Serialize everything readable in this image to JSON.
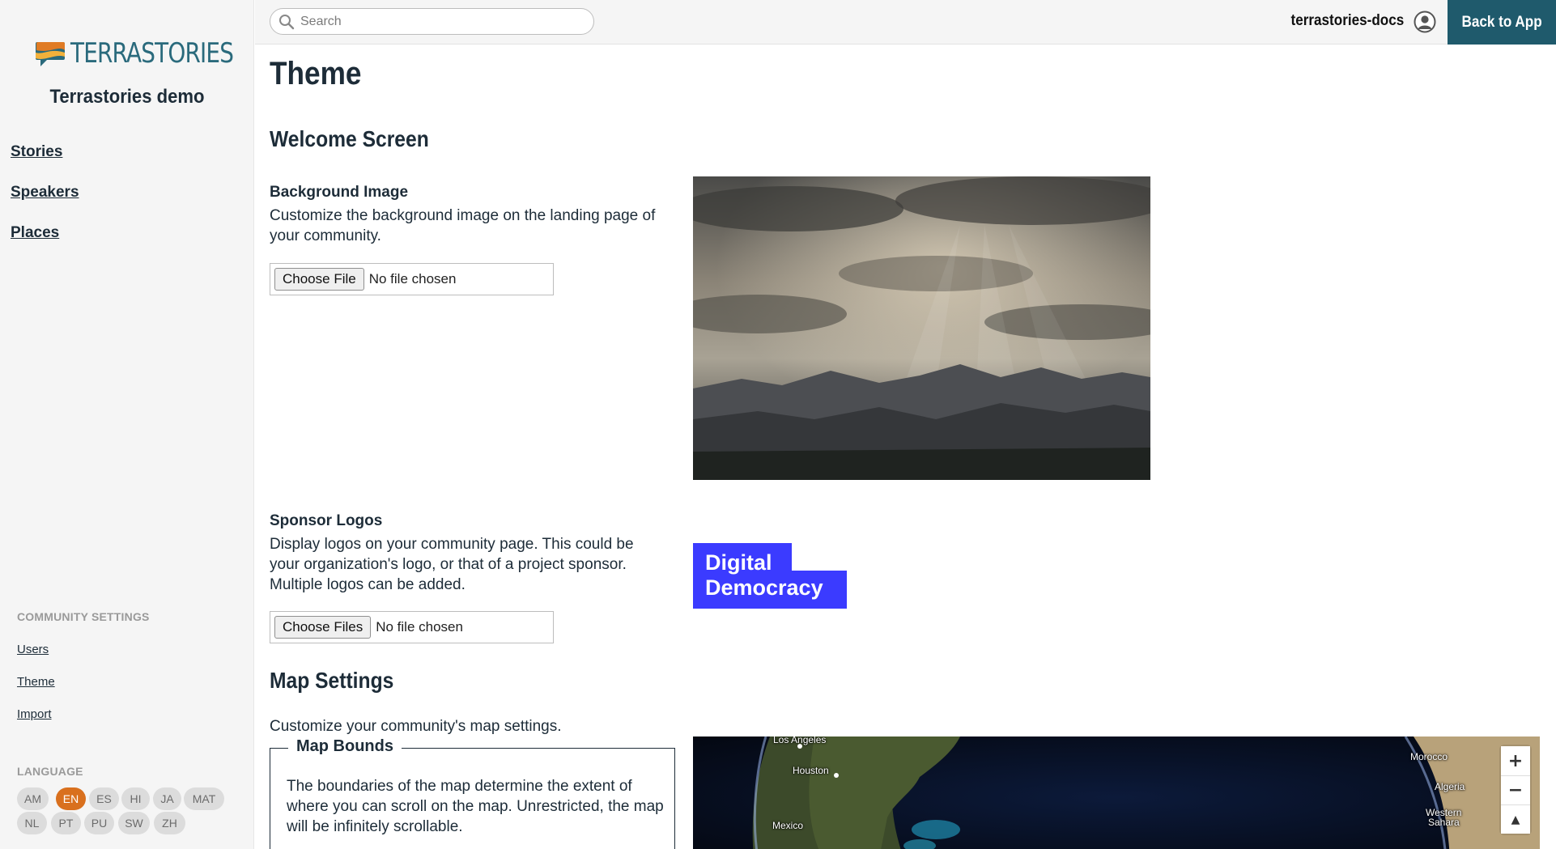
{
  "sidebar": {
    "logo_text": "TERRASTORIES",
    "community_name": "Terrastories demo",
    "nav": [
      {
        "label": "Stories"
      },
      {
        "label": "Speakers"
      },
      {
        "label": "Places"
      }
    ],
    "community_settings": {
      "heading": "COMMUNITY SETTINGS",
      "items": [
        {
          "label": "Users"
        },
        {
          "label": "Theme"
        },
        {
          "label": "Import"
        }
      ]
    },
    "language": {
      "heading": "LANGUAGE",
      "options": [
        "AM",
        "EN",
        "ES",
        "HI",
        "JA",
        "MAT",
        "NL",
        "PT",
        "PU",
        "SW",
        "ZH"
      ],
      "selected": "EN"
    }
  },
  "topbar": {
    "search_placeholder": "Search",
    "username": "terrastories-docs",
    "back_button": "Back to App"
  },
  "main": {
    "title": "Theme",
    "welcome": {
      "heading": "Welcome Screen",
      "background": {
        "label": "Background Image",
        "description": "Customize the background image on the landing page of your community.",
        "button": "Choose File",
        "status": "No file chosen"
      },
      "sponsors": {
        "label": "Sponsor Logos",
        "description": "Display logos on your community page. This could be your organization's logo, or that of a project sponsor. Multiple logos can be added.",
        "button": "Choose Files",
        "status": "No file chosen",
        "logo_line1": "Digital",
        "logo_line2": "Democracy",
        "logo_color": "#3b3bff"
      }
    },
    "map_settings": {
      "heading": "Map Settings",
      "description": "Customize your community's map settings.",
      "bounds": {
        "legend": "Map Bounds",
        "description": "The boundaries of the map determine the extent of where you can scroll on the map. Unrestricted, the map will be infinitely scrollable."
      },
      "map_labels": [
        "Los Angeles",
        "Houston",
        "Mexico",
        "Morocco",
        "Algeria",
        "Western",
        "Sahara"
      ],
      "controls": {
        "zoom_in": "+",
        "zoom_out": "−",
        "compass": "▲"
      }
    }
  },
  "colors": {
    "accent": "#1f5a6c",
    "language_active": "#d9701e",
    "text": "#1d2c38"
  }
}
